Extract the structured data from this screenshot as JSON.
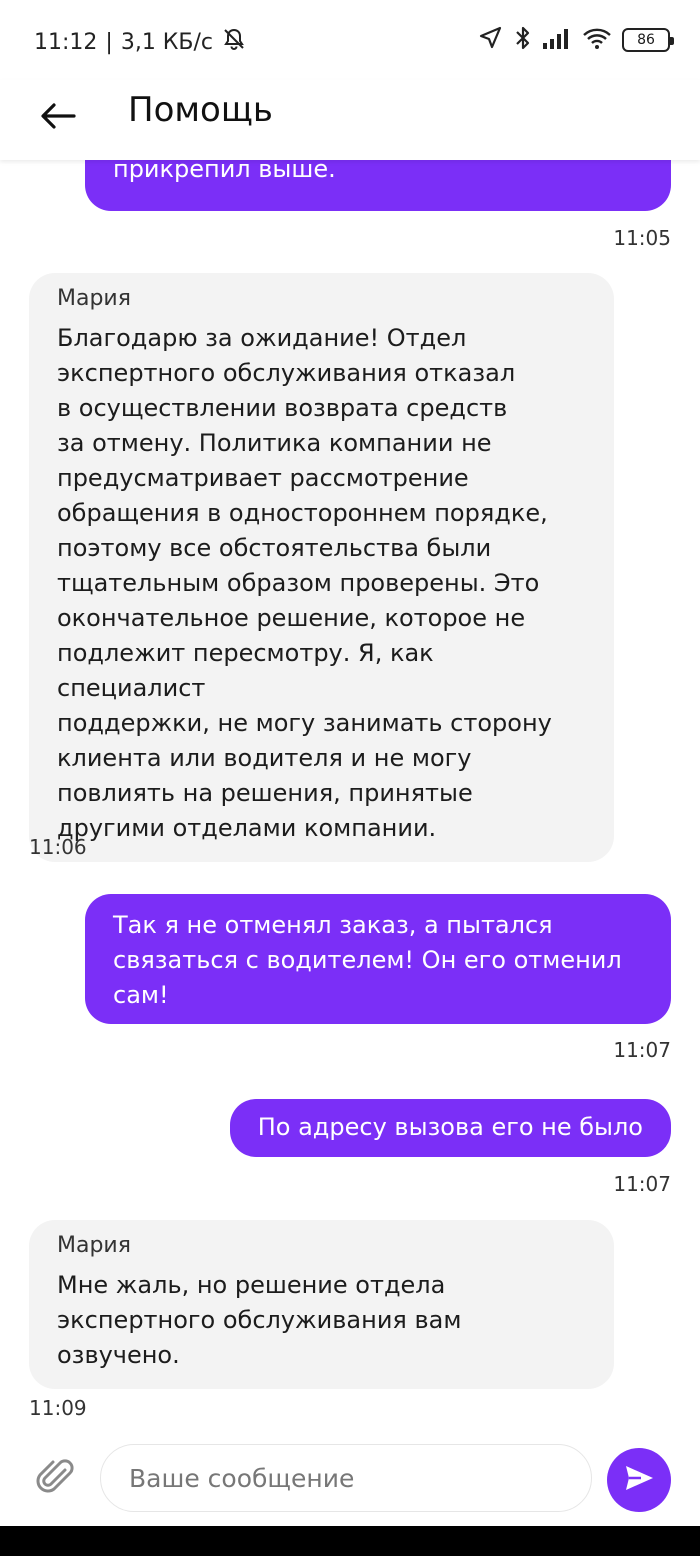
{
  "status_bar": {
    "time": "11:12",
    "network_speed": "3,1 КБ/с",
    "battery": "86"
  },
  "header": {
    "title": "Помощь"
  },
  "messages": [
    {
      "direction": "out",
      "text": "прикрепил выше.",
      "time": "11:05"
    },
    {
      "direction": "in",
      "sender": "Мария",
      "lines": [
        "Благодарю за ожидание!  Отдел",
        "экспертного обслуживания отказал",
        "в осуществлении возврата средств",
        "за отмену. Политика компании не",
        "предусматривает рассмотрение",
        "обращения в одностороннем порядке,",
        "поэтому все обстоятельства были",
        "тщательным образом проверены. Это",
        "окончательное решение, которое не",
        "подлежит пересмотру. Я, как специалист",
        "поддержки, не могу занимать сторону",
        "клиента или водителя и не могу",
        "повлиять на решения, принятые",
        "другими отделами компании."
      ],
      "time": "11:06"
    },
    {
      "direction": "out",
      "lines": [
        "Так я не отменял заказ, а пытался",
        "связаться с водителем! Он его отменил",
        "сам!"
      ],
      "time": "11:07"
    },
    {
      "direction": "out",
      "text": "По адресу вызова его не было",
      "time": "11:07"
    },
    {
      "direction": "in",
      "sender": "Мария",
      "lines": [
        "Мне жаль, но решение отдела",
        "экспертного обслуживания вам",
        "озвучено."
      ],
      "time": "11:09"
    }
  ],
  "composer": {
    "placeholder": "Ваше сообщение"
  },
  "colors": {
    "accent": "#7b2ff7",
    "incoming_bubble": "#f3f3f3"
  },
  "icons": {
    "back": "arrow-left-icon",
    "attach": "paperclip-icon",
    "send": "send-icon"
  }
}
